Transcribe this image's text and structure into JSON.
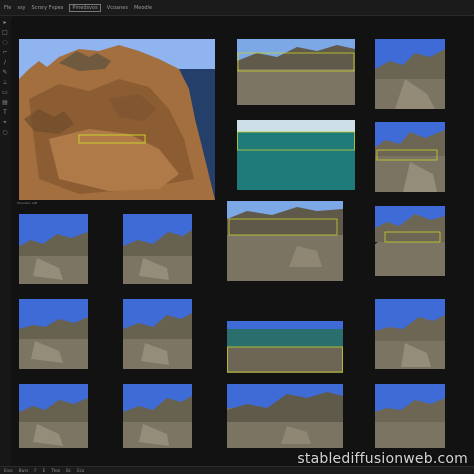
{
  "menubar": {
    "items": [
      "Fle",
      "ssy",
      "Scrsry Fvpes",
      "Pmedsvos",
      "Vcoanes",
      "Meodle"
    ]
  },
  "caption": "Mrsvaten aIM",
  "statusbar": {
    "items": [
      "Eros",
      "Bwrs",
      "F",
      "E",
      "Ttoe",
      "Bc",
      "Eca"
    ]
  },
  "watermark": "stablediffusionweb.com",
  "colors": {
    "sky": "#3f6bd6",
    "sea": "#1f7b7a",
    "rock": "#7a7464",
    "cliff": "#9b6a3e",
    "selection": "#c7d02a"
  }
}
